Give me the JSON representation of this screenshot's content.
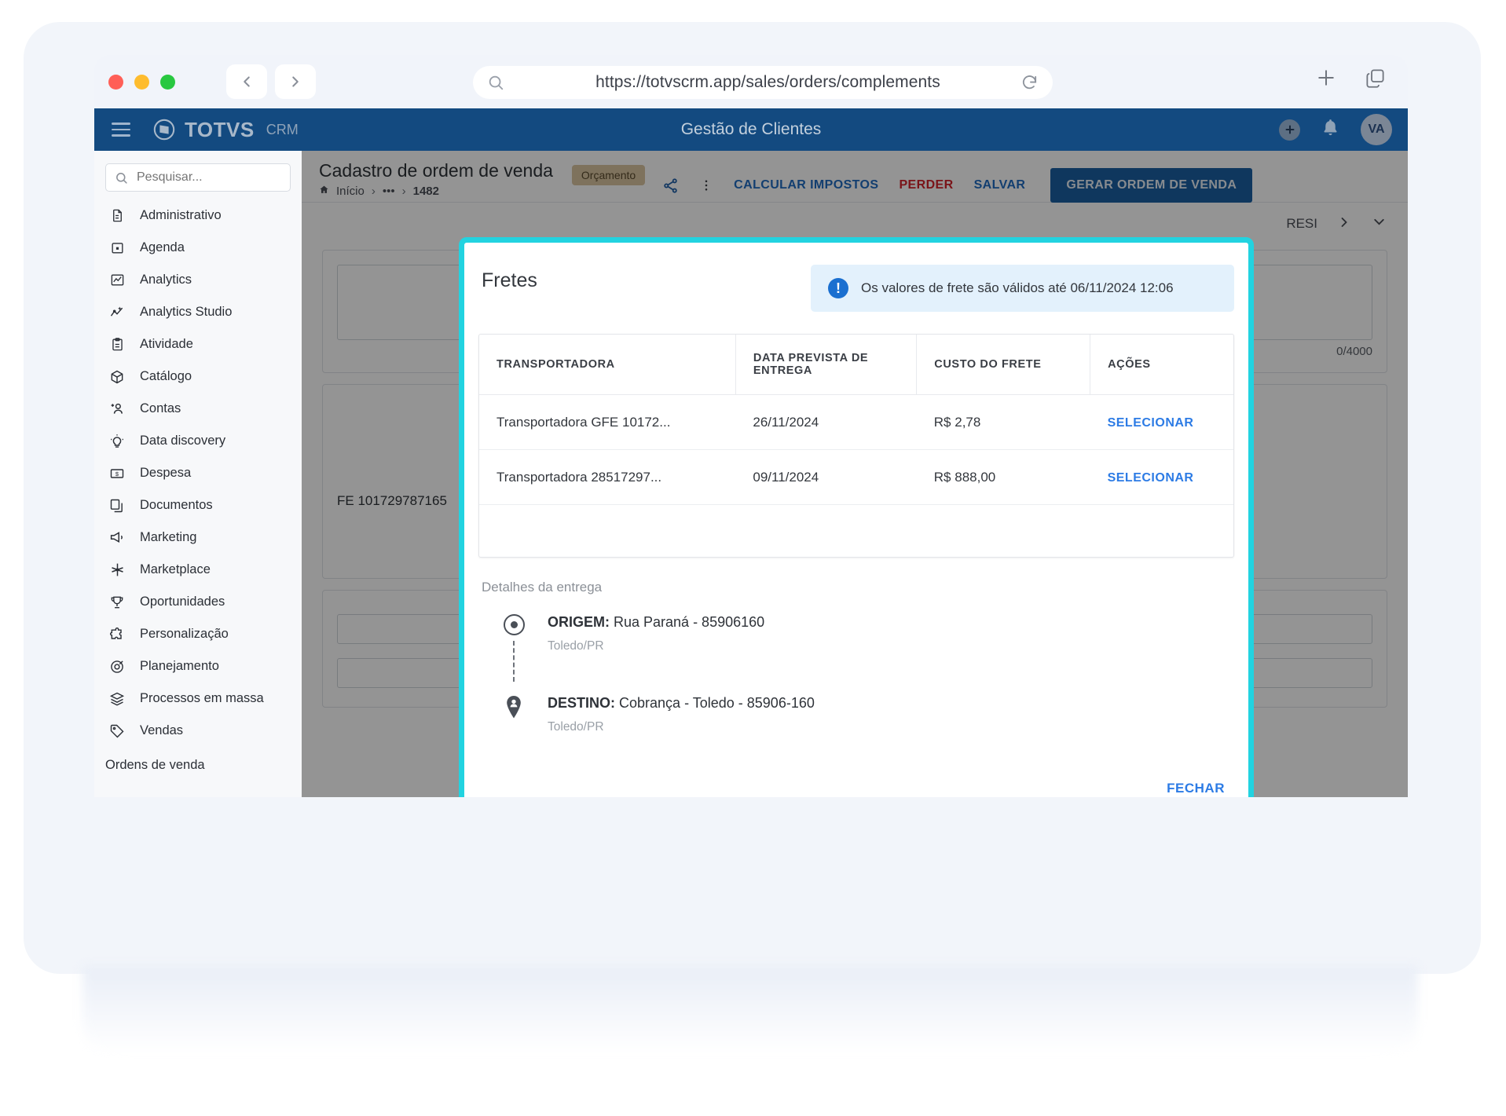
{
  "browser": {
    "url": "https://totvscrm.app/sales/orders/complements",
    "back_icon": "chevron-left-icon",
    "forward_icon": "chevron-right-icon",
    "search_icon": "search-icon",
    "reload_icon": "reload-icon",
    "new_tab_icon": "plus-icon",
    "tabs_icon": "copy-tabs-icon"
  },
  "topbar": {
    "menu_icon": "hamburger-icon",
    "brand": "TOTVS",
    "brand_sub": "CRM",
    "title": "Gestão de Clientes",
    "add_icon": "plus-circle-icon",
    "bell_icon": "bell-icon",
    "avatar_initials": "VA"
  },
  "sidebar": {
    "search_placeholder": "Pesquisar...",
    "items": [
      {
        "label": "Administrativo",
        "icon": "document-icon"
      },
      {
        "label": "Agenda",
        "icon": "calendar-icon"
      },
      {
        "label": "Analytics",
        "icon": "chart-icon"
      },
      {
        "label": "Analytics Studio",
        "icon": "analytics-studio-icon"
      },
      {
        "label": "Atividade",
        "icon": "clipboard-icon"
      },
      {
        "label": "Catálogo",
        "icon": "box-icon"
      },
      {
        "label": "Contas",
        "icon": "add-user-icon"
      },
      {
        "label": "Data discovery",
        "icon": "lightbulb-icon"
      },
      {
        "label": "Despesa",
        "icon": "money-icon"
      },
      {
        "label": "Documentos",
        "icon": "documents-icon"
      },
      {
        "label": "Marketing",
        "icon": "megaphone-icon"
      },
      {
        "label": "Marketplace",
        "icon": "marketplace-icon"
      },
      {
        "label": "Oportunidades",
        "icon": "trophy-icon"
      },
      {
        "label": "Personalização",
        "icon": "puzzle-icon"
      },
      {
        "label": "Planejamento",
        "icon": "target-icon"
      },
      {
        "label": "Processos em massa",
        "icon": "layers-icon"
      },
      {
        "label": "Vendas",
        "icon": "tag-icon"
      }
    ],
    "sub_item": "Ordens de venda"
  },
  "page_header": {
    "title": "Cadastro de ordem de venda",
    "breadcrumb": {
      "home_icon": "home-icon",
      "home": "Início",
      "sep": "›",
      "ellipsis": "•••",
      "current": "1482"
    },
    "badge": "Orçamento",
    "share_icon": "share-icon",
    "more_icon": "more-vertical-icon",
    "actions": {
      "calcular": "CALCULAR IMPOSTOS",
      "perder": "PERDER",
      "salvar": "SALVAR",
      "gerar": "GERAR ORDEM DE VENDA"
    }
  },
  "background_panel": {
    "tab_label": "RESI",
    "next_icon": "chevron-right-icon",
    "collapse_icon": "chevron-down-icon",
    "char_count": "0/4000",
    "gfe_text": "FE 101729787165"
  },
  "modal": {
    "title": "Fretes",
    "info_icon": "exclamation-circle-icon",
    "info_text": "Os valores de frete são válidos até 06/11/2024 12:06",
    "table": {
      "headers": [
        "TRANSPORTADORA",
        "DATA PREVISTA DE ENTREGA",
        "CUSTO DO FRETE",
        "AÇÕES"
      ],
      "rows": [
        {
          "transportadora": "Transportadora GFE 10172...",
          "data": "26/11/2024",
          "custo": "R$ 2,78",
          "custo_highlight": true,
          "acao": "SELECIONAR"
        },
        {
          "transportadora": "Transportadora 28517297...",
          "data": "09/11/2024",
          "custo": "R$ 888,00",
          "custo_highlight": false,
          "acao": "SELECIONAR"
        }
      ]
    },
    "details_label": "Detalhes da entrega",
    "origem": {
      "label": "ORIGEM:",
      "value": " Rua Paraná - 85906160",
      "city": "Toledo/PR",
      "icon": "origin-dot-icon"
    },
    "destino": {
      "label": "DESTINO:",
      "value": " Cobrança - Toledo - 85906-160",
      "city": "Toledo/PR",
      "icon": "map-pin-icon"
    },
    "close_label": "FECHAR",
    "border_color": "#22d3e0"
  },
  "colors": {
    "brand_blue": "#134a80",
    "accent_teal": "#22d3e0",
    "link_blue": "#2c7be5",
    "danger_red": "#d3242c",
    "success_green": "#3a9a58"
  }
}
